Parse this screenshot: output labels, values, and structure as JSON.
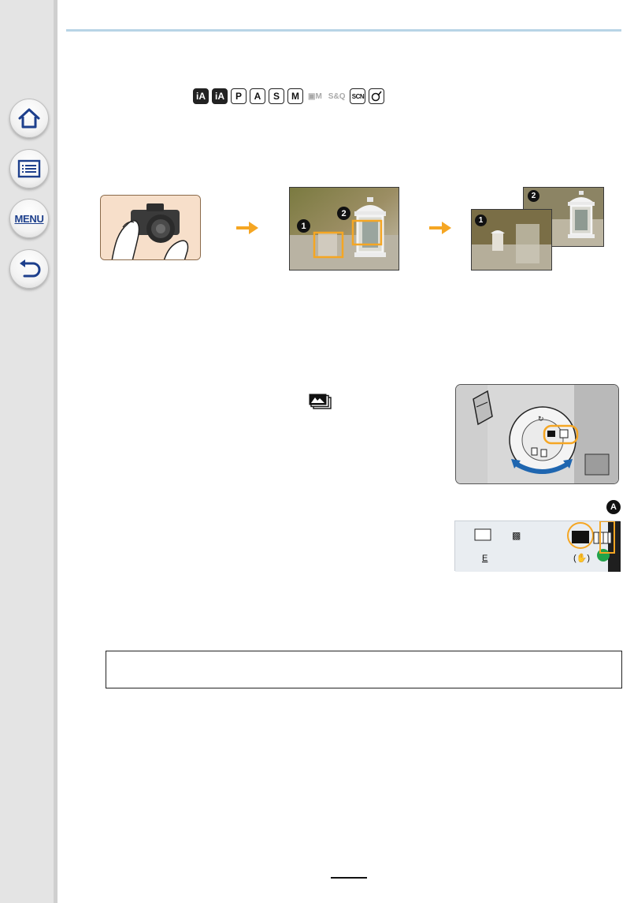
{
  "navigation": {
    "home_icon": "home-icon",
    "toc_icon": "list-icon",
    "menu_label": "MENU",
    "back_icon": "return-icon"
  },
  "mode_icons": [
    "iA",
    "iA+",
    "P",
    "A",
    "S",
    "M",
    "▓M",
    "S&Q",
    "SCN",
    "creative-icon"
  ],
  "mode_labels": {
    "ia": "iA",
    "ia_plus": "iA",
    "p": "P",
    "a": "A",
    "s": "S",
    "m": "M",
    "video_m": "M",
    "snq": "S&Q",
    "scn": "SCN"
  },
  "illustrations": {
    "step_markers": [
      "1",
      "2"
    ],
    "dial_callout": "A"
  },
  "page_number": "",
  "colors": {
    "accent_orange": "#f5a623",
    "rule_blue": "#b8d4e6",
    "dial_blue": "#1f66b0",
    "green_dot": "#22a34a"
  }
}
